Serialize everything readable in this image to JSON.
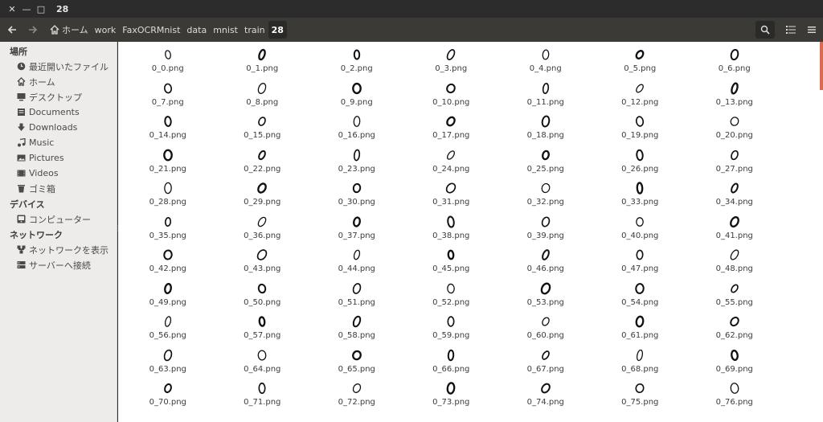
{
  "window": {
    "title": "28",
    "close_icon": "close-icon",
    "minimize_icon": "minimize-icon",
    "maximize_icon": "maximize-icon"
  },
  "toolbar": {
    "back_icon": "arrow-left-icon",
    "forward_icon": "arrow-right-icon",
    "breadcrumbs": [
      "ホーム",
      "work",
      "FaxOCRMnist",
      "data",
      "mnist",
      "train",
      "28"
    ],
    "search_icon": "search-icon",
    "list_view_icon": "list-view-icon",
    "menu_icon": "hamburger-menu-icon"
  },
  "sidebar": {
    "sections": [
      {
        "heading": "場所",
        "items": [
          {
            "label": "最近開いたファイル",
            "icon": "clock-icon"
          },
          {
            "label": "ホーム",
            "icon": "home-icon"
          },
          {
            "label": "デスクトップ",
            "icon": "desktop-icon"
          },
          {
            "label": "Documents",
            "icon": "document-icon"
          },
          {
            "label": "Downloads",
            "icon": "download-icon"
          },
          {
            "label": "Music",
            "icon": "music-icon"
          },
          {
            "label": "Pictures",
            "icon": "pictures-icon"
          },
          {
            "label": "Videos",
            "icon": "videos-icon"
          },
          {
            "label": "ゴミ箱",
            "icon": "trash-icon"
          }
        ]
      },
      {
        "heading": "デバイス",
        "items": [
          {
            "label": "コンピューター",
            "icon": "computer-icon"
          }
        ]
      },
      {
        "heading": "ネットワーク",
        "items": [
          {
            "label": "ネットワークを表示",
            "icon": "network-icon"
          },
          {
            "label": "サーバーへ接続",
            "icon": "server-icon"
          }
        ]
      }
    ]
  },
  "files": [
    "0_0.png",
    "0_1.png",
    "0_2.png",
    "0_3.png",
    "0_4.png",
    "0_5.png",
    "0_6.png",
    "0_7.png",
    "0_8.png",
    "0_9.png",
    "0_10.png",
    "0_11.png",
    "0_12.png",
    "0_13.png",
    "0_14.png",
    "0_15.png",
    "0_16.png",
    "0_17.png",
    "0_18.png",
    "0_19.png",
    "0_20.png",
    "0_21.png",
    "0_22.png",
    "0_23.png",
    "0_24.png",
    "0_25.png",
    "0_26.png",
    "0_27.png",
    "0_28.png",
    "0_29.png",
    "0_30.png",
    "0_31.png",
    "0_32.png",
    "0_33.png",
    "0_34.png",
    "0_35.png",
    "0_36.png",
    "0_37.png",
    "0_38.png",
    "0_39.png",
    "0_40.png",
    "0_41.png",
    "0_42.png",
    "0_43.png",
    "0_44.png",
    "0_45.png",
    "0_46.png",
    "0_47.png",
    "0_48.png",
    "0_49.png",
    "0_50.png",
    "0_51.png",
    "0_52.png",
    "0_53.png",
    "0_54.png",
    "0_55.png",
    "0_56.png",
    "0_57.png",
    "0_58.png",
    "0_59.png",
    "0_60.png",
    "0_61.png",
    "0_62.png",
    "0_63.png",
    "0_64.png",
    "0_65.png",
    "0_66.png",
    "0_67.png",
    "0_68.png",
    "0_69.png",
    "0_70.png",
    "0_71.png",
    "0_72.png",
    "0_73.png",
    "0_74.png",
    "0_75.png",
    "0_76.png"
  ],
  "colors": {
    "accent": "#d96b52",
    "sidebar_bg": "#edecea",
    "toolbar_bg": "#3b3a36"
  }
}
